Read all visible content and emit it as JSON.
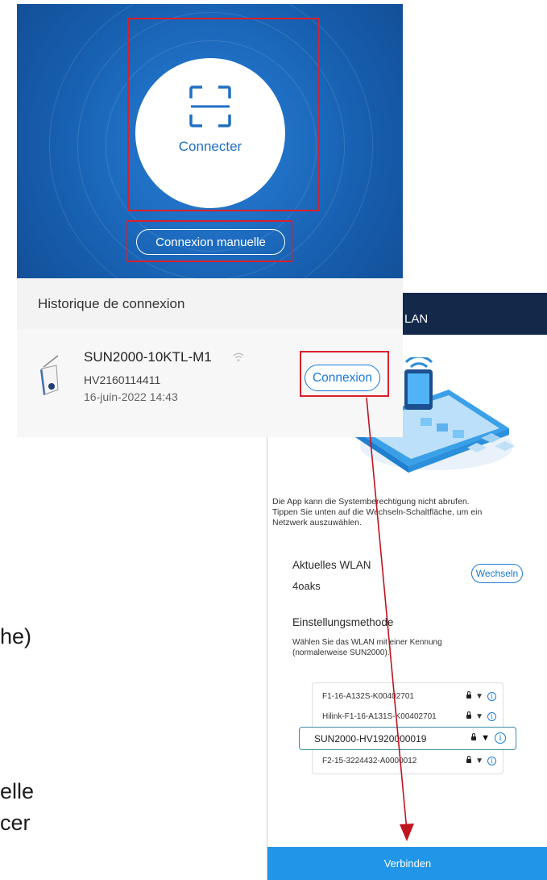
{
  "background_fragments": {
    "frag1": "he)",
    "frag2": "elle",
    "frag3": "cer"
  },
  "phone1": {
    "scan_button_label": "Connecter",
    "manual_button_label": "Connexion manuelle",
    "history_title": "Historique de connexion",
    "device": {
      "name": "SUN2000-10KTL-M1",
      "serial": "HV2160114411",
      "date": "16-juin-2022 14:43",
      "connect_label": "Connexion"
    }
  },
  "phone2": {
    "title": "LAN",
    "info_text_1": "Die App kann die Systemberechtigung nicht abrufen.",
    "info_text_2": "Tippen Sie unten auf die Wechseln-Schaltfläche, um ein",
    "info_text_3": "Netzwerk auszuwählen.",
    "current_wlan_label": "Aktuelles WLAN",
    "current_wlan_value": "4oaks",
    "switch_label": "Wechseln",
    "setting_method_label": "Einstellungsmethode",
    "hint_1": "Wählen Sie das WLAN mit einer Kennung",
    "hint_2": "(normalerweise SUN2000).",
    "networks": [
      "F1-16-A132S-K00402701",
      "Hilink-F1-16-A131S-K00402701",
      "SUN2000-HV1920000019",
      "F2-15-3224432-A0000012"
    ],
    "connect_label": "Verbinden"
  },
  "colors": {
    "brand_blue": "#1f6fc4",
    "highlight_red": "#d8202c",
    "header_navy": "#14294a",
    "button_blue": "#2196e8"
  }
}
